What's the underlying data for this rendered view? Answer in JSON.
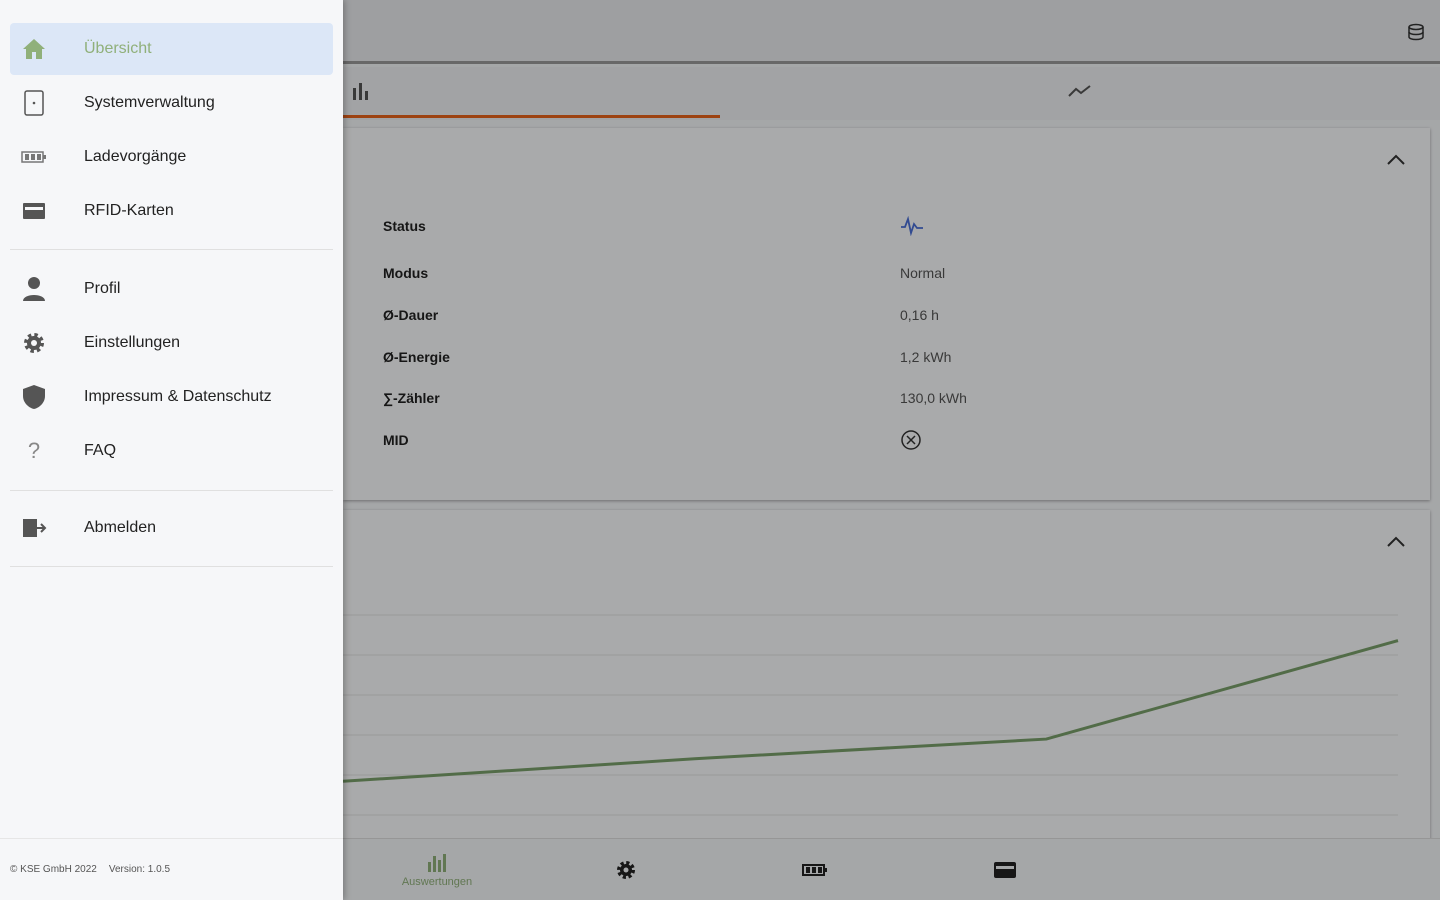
{
  "drawer": {
    "items": [
      {
        "label": "Übersicht",
        "icon": "home-icon"
      },
      {
        "label": "Systemverwaltung",
        "icon": "device-icon"
      },
      {
        "label": "Ladevorgänge",
        "icon": "battery-icon"
      },
      {
        "label": "RFID-Karten",
        "icon": "card-icon"
      },
      {
        "label": "Profil",
        "icon": "person-icon"
      },
      {
        "label": "Einstellungen",
        "icon": "gear-icon"
      },
      {
        "label": "Impressum & Datenschutz",
        "icon": "shield-icon"
      },
      {
        "label": "FAQ",
        "icon": "question-icon"
      },
      {
        "label": "Abmelden",
        "icon": "logout-icon"
      }
    ],
    "footer": {
      "copyright": "© KSE GmbH 2022",
      "version": "Version: 1.0.5"
    }
  },
  "status_card": {
    "rows": [
      {
        "key": "Status",
        "value": ""
      },
      {
        "key": "Modus",
        "value": "Normal"
      },
      {
        "key": "Ø-Dauer",
        "value": "0,16 h"
      },
      {
        "key": "Ø-Energie",
        "value": "1,2 kWh"
      },
      {
        "key": "∑-Zähler",
        "value": "130,0 kWh"
      },
      {
        "key": "MID",
        "value": ""
      }
    ]
  },
  "bottom_nav": {
    "items": [
      {
        "label": "Auswertungen",
        "icon": "bar-chart-icon"
      },
      {
        "label": "",
        "icon": "gear-icon"
      },
      {
        "label": "",
        "icon": "battery-icon"
      },
      {
        "label": "",
        "icon": "card-icon"
      }
    ]
  },
  "colors": {
    "accent": "#e8621a",
    "active_green": "#90b07a",
    "line": "#7aa06a",
    "drawer_active_bg": "#dce7f7"
  },
  "chart_data": {
    "type": "line",
    "series": [
      {
        "values": [
          0.6,
          1.0,
          1.35,
          3.1
        ]
      }
    ],
    "x": [
      0,
      1,
      2,
      3
    ],
    "ylim": [
      0,
      4
    ],
    "grid": true
  }
}
